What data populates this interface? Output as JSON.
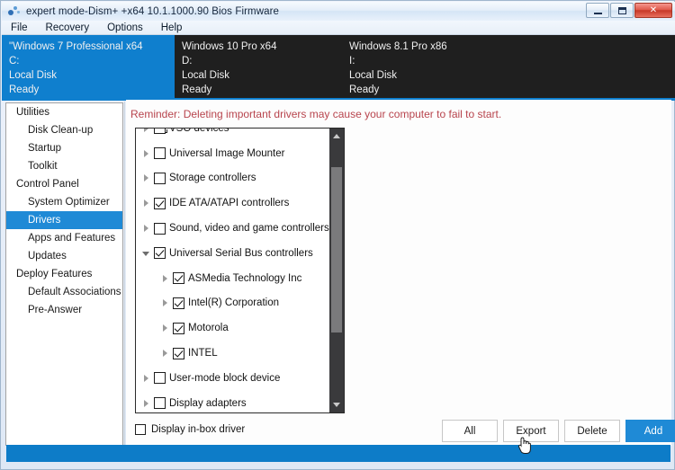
{
  "window": {
    "title": "expert mode-Dism+ +x64 10.1.1000.90 Bios Firmware",
    "icon": "app-gear-icon",
    "minimize_label": "Minimize",
    "maximize_label": "Maximize",
    "close_label": "✕"
  },
  "menu": {
    "items": [
      {
        "label": "File"
      },
      {
        "label": "Recovery"
      },
      {
        "label": "Options"
      },
      {
        "label": "Help"
      }
    ]
  },
  "targets": {
    "selected_index": 0,
    "accent": "#0f7fce",
    "background": "#1f1f1f",
    "items": [
      {
        "name": "\"Windows 7 Professional x64",
        "drive": "C:",
        "type": "Local Disk",
        "status": "Ready"
      },
      {
        "name": "Windows 10 Pro x64",
        "drive": "D:",
        "type": "Local Disk",
        "status": "Ready"
      },
      {
        "name": "Windows 8.1 Pro x86",
        "drive": "I:",
        "type": "Local Disk",
        "status": "Ready"
      }
    ]
  },
  "sidebar": {
    "active": "Drivers",
    "highlight_color": "#1f8ad6",
    "groups": [
      {
        "header": "Utilities",
        "items": [
          {
            "label": "Disk Clean-up",
            "active": false
          },
          {
            "label": "Startup",
            "active": false
          },
          {
            "label": "Toolkit",
            "active": false
          }
        ]
      },
      {
        "header": "Control Panel",
        "items": [
          {
            "label": "System Optimizer",
            "active": false
          },
          {
            "label": "Drivers",
            "active": true
          },
          {
            "label": "Apps and Features",
            "active": false
          },
          {
            "label": "Updates",
            "active": false
          }
        ]
      },
      {
        "header": "Deploy Features",
        "items": [
          {
            "label": "Default Associations",
            "active": false
          },
          {
            "label": "Pre-Answer",
            "active": false
          }
        ]
      }
    ]
  },
  "content": {
    "reminder": "Reminder: Deleting important drivers may cause your computer to fail to start.",
    "reminder_color": "#b8444d",
    "tree": [
      {
        "label": "VSO devices",
        "level": 1,
        "checked": false,
        "expanded": false
      },
      {
        "label": "Universal Image Mounter",
        "level": 1,
        "checked": false,
        "expanded": false
      },
      {
        "label": "Storage controllers",
        "level": 1,
        "checked": false,
        "expanded": false
      },
      {
        "label": "IDE ATA/ATAPI controllers",
        "level": 1,
        "checked": true,
        "expanded": false
      },
      {
        "label": "Sound, video and game controllers",
        "level": 1,
        "checked": false,
        "expanded": false
      },
      {
        "label": "Universal Serial Bus controllers",
        "level": 1,
        "checked": true,
        "expanded": true
      },
      {
        "label": "ASMedia Technology Inc",
        "level": 2,
        "checked": true,
        "expanded": false
      },
      {
        "label": "Intel(R) Corporation",
        "level": 2,
        "checked": true,
        "expanded": false
      },
      {
        "label": "Motorola",
        "level": 2,
        "checked": true,
        "expanded": false
      },
      {
        "label": "INTEL",
        "level": 2,
        "checked": true,
        "expanded": false
      },
      {
        "label": "User-mode block device",
        "level": 1,
        "checked": false,
        "expanded": false
      },
      {
        "label": "Display adapters",
        "level": 1,
        "checked": false,
        "expanded": false
      }
    ],
    "inbox_driver": {
      "label": "Display in-box driver",
      "checked": false
    },
    "buttons": [
      {
        "label": "All",
        "primary": false
      },
      {
        "label": "Export",
        "primary": false
      },
      {
        "label": "Delete",
        "primary": false
      },
      {
        "label": "Add",
        "primary": true
      }
    ]
  },
  "statusbar": {
    "text": "",
    "color": "#0d7cc8"
  }
}
